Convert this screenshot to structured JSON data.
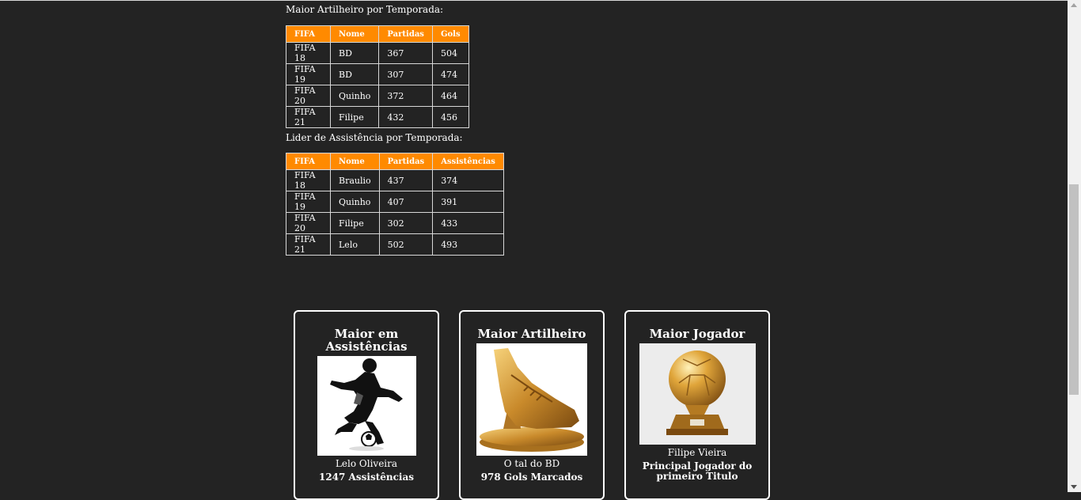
{
  "scorers": {
    "title": "Maior Artilheiro por Temporada:",
    "headers": [
      "FIFA",
      "Nome",
      "Partidas",
      "Gols"
    ],
    "rows": [
      [
        "FIFA 18",
        "BD",
        "367",
        "504"
      ],
      [
        "FIFA 19",
        "BD",
        "307",
        "474"
      ],
      [
        "FIFA 20",
        "Quinho",
        "372",
        "464"
      ],
      [
        "FIFA 21",
        "Filipe",
        "432",
        "456"
      ]
    ]
  },
  "assists": {
    "title": "Lider de Assistência por Temporada:",
    "headers": [
      "FIFA",
      "Nome",
      "Partidas",
      "Assistências"
    ],
    "rows": [
      [
        "FIFA 18",
        "Braulio",
        "437",
        "374"
      ],
      [
        "FIFA 19",
        "Quinho",
        "407",
        "391"
      ],
      [
        "FIFA 20",
        "Filipe",
        "302",
        "433"
      ],
      [
        "FIFA 21",
        "Lelo",
        "502",
        "493"
      ]
    ]
  },
  "cards": [
    {
      "title": "Maior em Assistências",
      "name": "Lelo Oliveira",
      "value": "1247 Assistências",
      "image": "footballer-silhouette"
    },
    {
      "title": "Maior Artilheiro",
      "name": "O tal do BD",
      "value": "978 Gols Marcados",
      "image": "golden-boot-trophy"
    },
    {
      "title": "Maior Jogador",
      "name": "Filipe Vieira",
      "value": "Principal Jogador do primeiro Titulo",
      "image": "golden-ball-trophy"
    }
  ]
}
